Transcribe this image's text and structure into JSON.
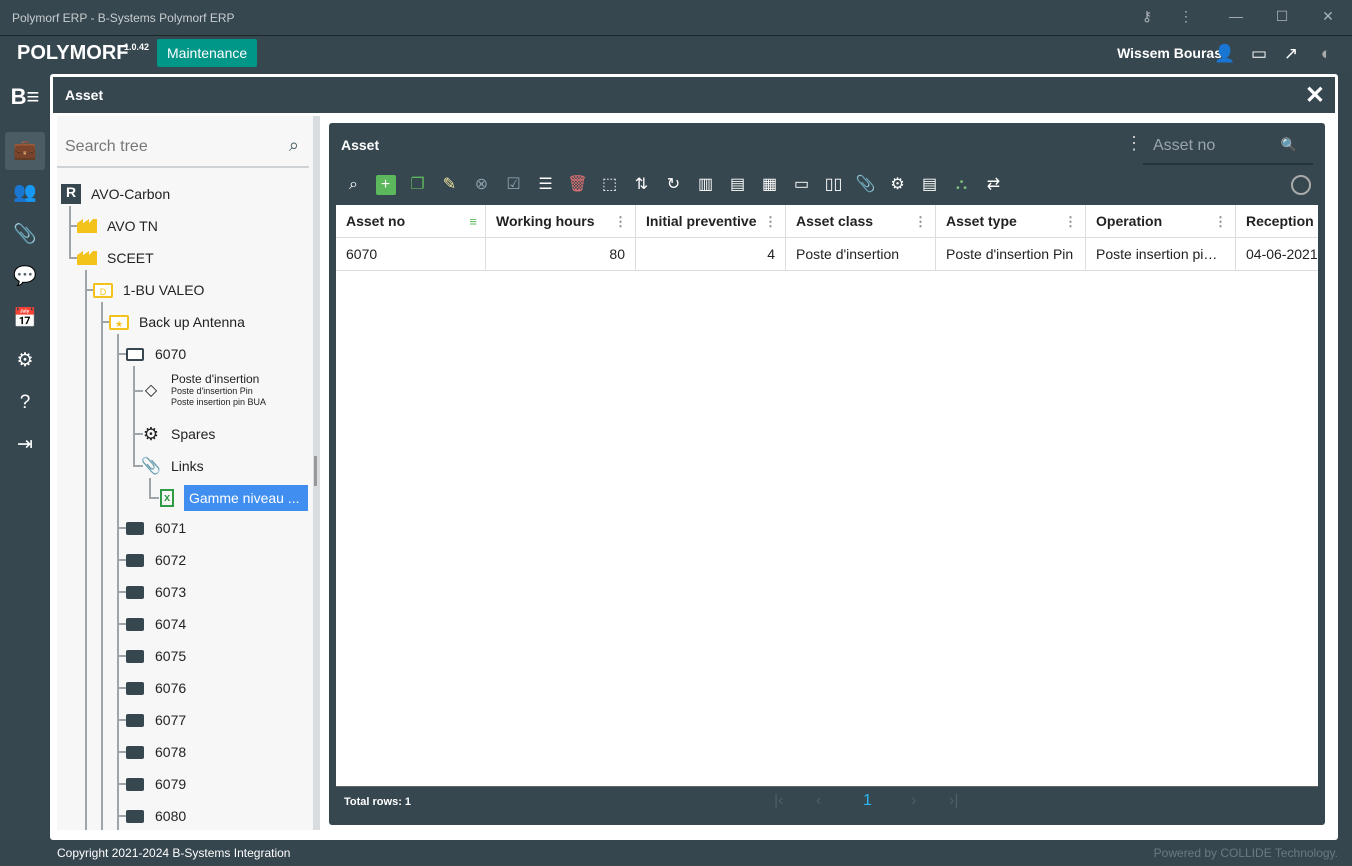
{
  "window": {
    "title": "Polymorf ERP - B-Systems Polymorf ERP"
  },
  "header": {
    "app_name": "POLYMORF",
    "version": "1.0.42",
    "module": "Maintenance",
    "user": "Wissem Bouras"
  },
  "asset_window": {
    "title": "Asset"
  },
  "tree": {
    "search_placeholder": "Search tree",
    "items": [
      {
        "label": "AVO-Carbon"
      },
      {
        "label": "AVO TN"
      },
      {
        "label": "SCEET"
      },
      {
        "label": "1-BU VALEO"
      },
      {
        "label": "Back up Antenna"
      },
      {
        "label": "6070"
      },
      {
        "label": "Poste d'insertion",
        "sub1": "Poste d'insertion Pin",
        "sub2": "Poste insertion pin BUA"
      },
      {
        "label": "Spares"
      },
      {
        "label": "Links"
      },
      {
        "label": "Gamme niveau ..."
      },
      {
        "label": "6071"
      },
      {
        "label": "6072"
      },
      {
        "label": "6073"
      },
      {
        "label": "6074"
      },
      {
        "label": "6075"
      },
      {
        "label": "6076"
      },
      {
        "label": "6077"
      },
      {
        "label": "6078"
      },
      {
        "label": "6079"
      },
      {
        "label": "6080"
      }
    ]
  },
  "grid": {
    "title": "Asset",
    "search_placeholder": "Asset no",
    "columns": [
      "Asset no",
      "Working hours",
      "Initial preventive",
      "Asset class",
      "Asset type",
      "Operation",
      "Reception d"
    ],
    "rows": [
      [
        "6070",
        "80",
        "4",
        "Poste d'insertion",
        "Poste d'insertion Pin",
        "Poste insertion pin ...",
        "04-06-2021"
      ]
    ],
    "total_rows": "Total rows: 1",
    "current_page": "1"
  },
  "footer": {
    "copyright": "Copyright 2021-2024 B-Systems Integration",
    "powered": "Powered by COLLIDE Technology."
  }
}
